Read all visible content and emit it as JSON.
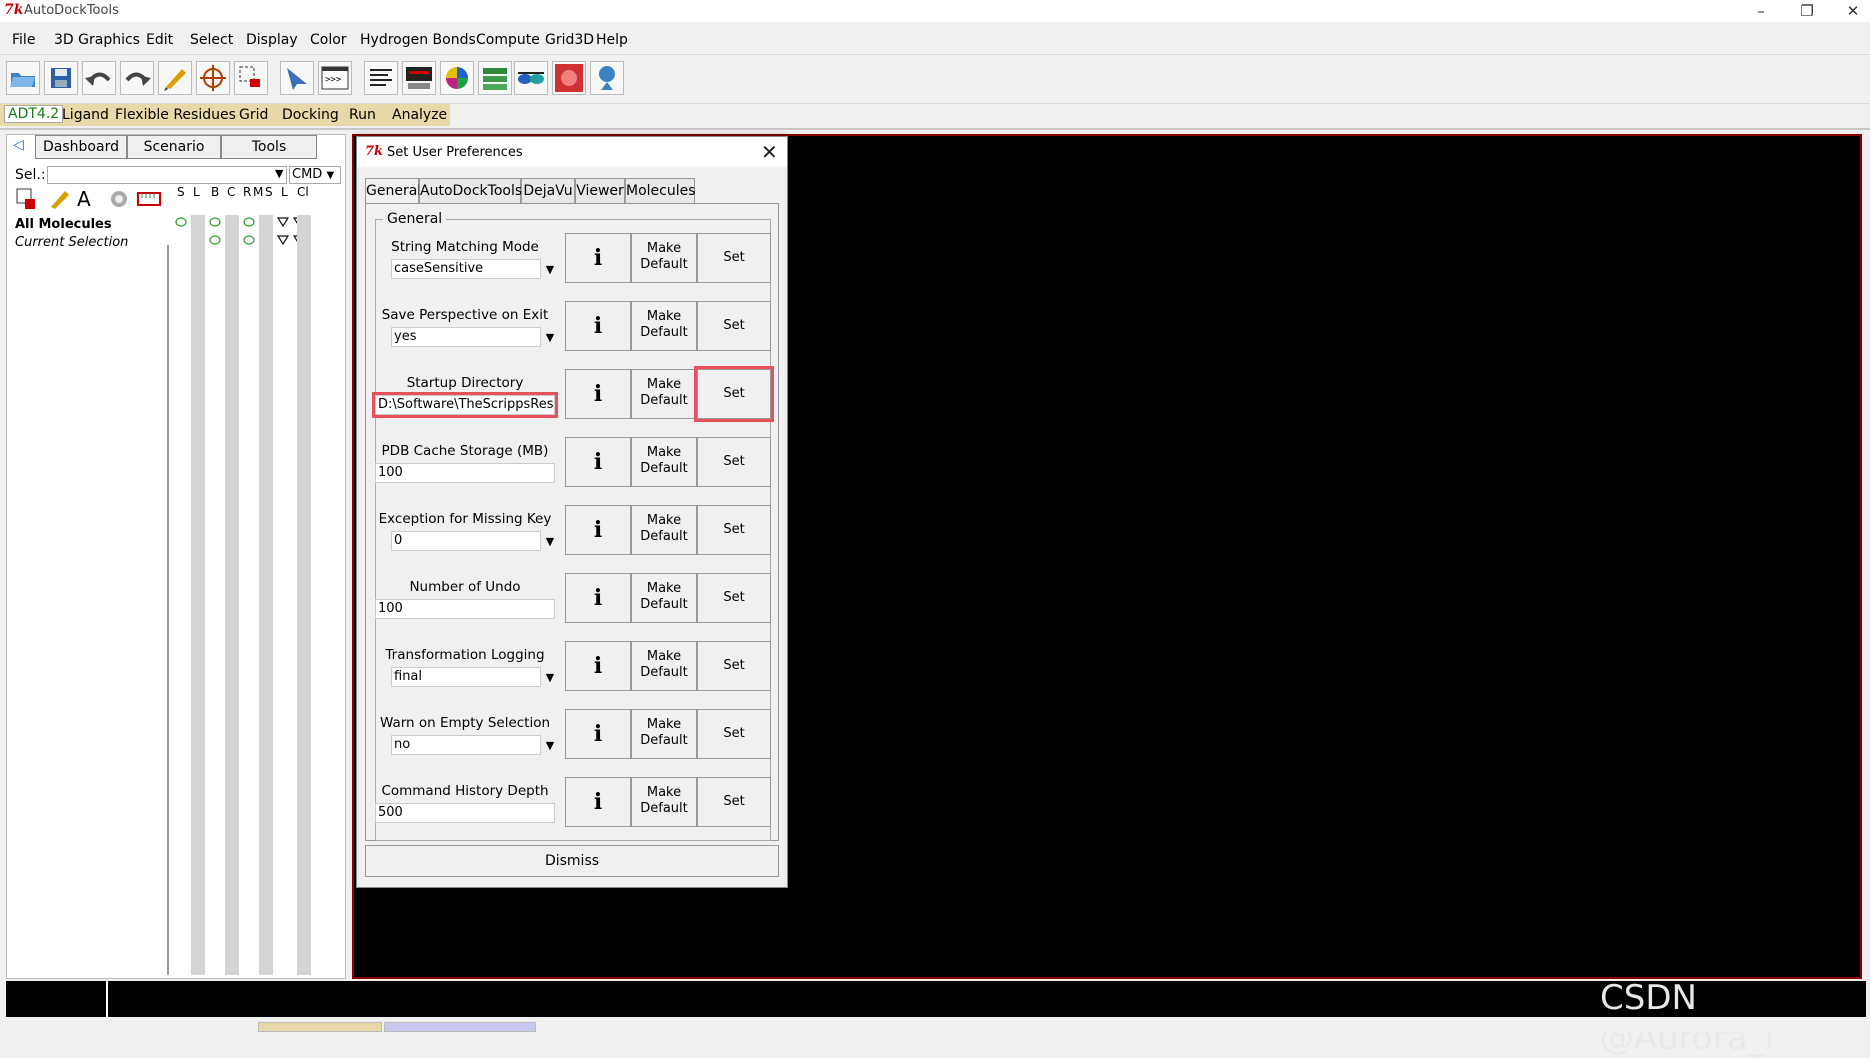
{
  "window": {
    "title": "AutoDockTools",
    "minimize": "–",
    "restore": "❐",
    "close": "✕"
  },
  "menubar": [
    "File",
    "3D Graphics",
    "Edit",
    "Select",
    "Display",
    "Color",
    "Hydrogen Bonds",
    "Compute",
    "Grid3D",
    "Help"
  ],
  "modules": [
    "ADT4.2",
    "Ligand",
    "Flexible Residues",
    "Grid",
    "Docking",
    "Run",
    "Analyze"
  ],
  "left_panel": {
    "tabs": [
      "Dashboard",
      "Scenario",
      "Tools"
    ],
    "sel_label": "Sel.:",
    "cmd_label": "CMD",
    "columns": [
      "S",
      "L",
      "B",
      "C",
      "R",
      "M",
      "S",
      "L",
      "Cl"
    ],
    "tree": [
      "All Molecules",
      "Current Selection"
    ]
  },
  "dialog": {
    "title": "Set User Preferences",
    "tabs": [
      "General",
      "AutoDockTools",
      "DejaVu",
      "Viewer",
      "Molecules"
    ],
    "group": "General",
    "info_glyph": "i",
    "make_default": "Make Default",
    "set_label": "Set",
    "dismiss": "Dismiss",
    "rows": [
      {
        "label": "String Matching Mode",
        "value": "caseSensitive",
        "combo": true
      },
      {
        "label": "Save Perspective on Exit",
        "value": "yes",
        "combo": true
      },
      {
        "label": "Startup Directory",
        "value": "D:\\Software\\TheScrippsResea",
        "combo": false,
        "highlighted": true
      },
      {
        "label": "PDB Cache Storage (MB)",
        "value": "100",
        "combo": false
      },
      {
        "label": "Exception for Missing Key",
        "value": "0",
        "combo": true
      },
      {
        "label": "Number of Undo",
        "value": "100",
        "combo": false
      },
      {
        "label": "Transformation Logging",
        "value": "final",
        "combo": true
      },
      {
        "label": "Warn on Empty Selection",
        "value": "no",
        "combo": true
      },
      {
        "label": "Command History Depth",
        "value": "500",
        "combo": false
      }
    ]
  },
  "watermark": "CSDN @Aurora_i",
  "colors": {
    "highlight": "#e8505b",
    "viewer_border": "#8b0000",
    "module_bar": "#e8d9a8"
  }
}
